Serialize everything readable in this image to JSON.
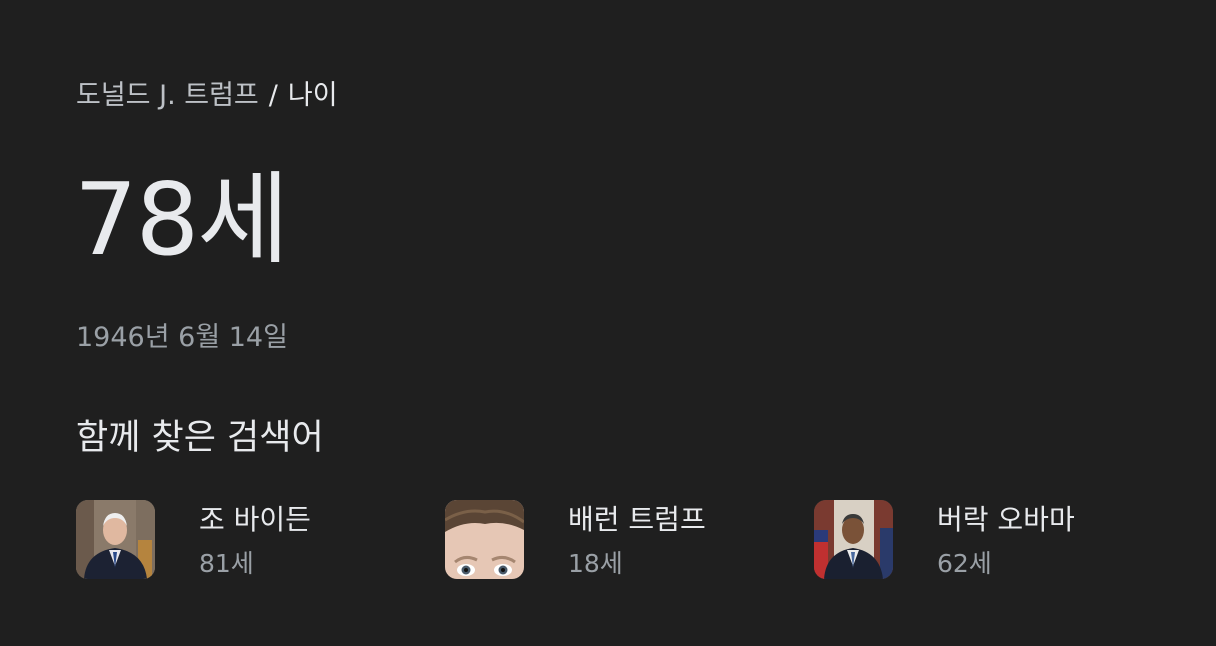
{
  "breadcrumb": {
    "entity": "도널드 J. 트럼프",
    "separator": "/",
    "attribute": "나이"
  },
  "answer": "78세",
  "birthdate": "1946년 6월 14일",
  "related": {
    "title": "함께 찾은 검색어",
    "items": [
      {
        "name": "조 바이든",
        "age": "81세",
        "thumb_icon": "person-portrait-icon"
      },
      {
        "name": "배런 트럼프",
        "age": "18세",
        "thumb_icon": "person-face-closeup-icon"
      },
      {
        "name": "버락 오바마",
        "age": "62세",
        "thumb_icon": "person-portrait-icon"
      }
    ]
  },
  "colors": {
    "background": "#1f1f1f",
    "primary_text": "#e8eaed",
    "secondary_text": "#9aa0a6"
  }
}
